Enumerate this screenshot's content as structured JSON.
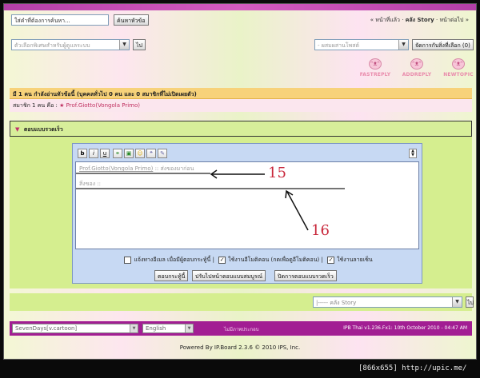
{
  "header": {
    "search_placeholder": "ใส่คำที่ต้องการค้นหา...",
    "search_button": "ค้นหาหัวข้อ",
    "nav_prev": "« หน้าที่แล้ว",
    "nav_separator": "·",
    "nav_current": "คลัง Story",
    "nav_next": "หน้าต่อไป »"
  },
  "moderation": {
    "left_select": "ตัวเลือกพิเศษสำหรับผู้ดูแลระบบ",
    "left_go": "ไป",
    "right_select": "- ผสมผสานโพสต์",
    "clear_button": "จัดการกับสิ่งที่เลือก (0)"
  },
  "action_buttons": [
    "FASTREPLY",
    "ADDREPLY",
    "NEWTOPIC"
  ],
  "viewing": {
    "header": "มี 1 คน กำลังอ่านหัวข้อนี้ (บุคคลทั่วไป 0 คน และ 0 สมาชิกที่ไม่เปิดเผยตัว)",
    "members_label": "สมาชิก 1 คน คือ :",
    "member_name": "Prof.Giotto(Vongola Primo)"
  },
  "quick_reply": {
    "title": "ตอบแบบรวดเร็ว",
    "toolbar_icons": [
      "bold-icon",
      "italic-icon",
      "underline-icon",
      "link-icon",
      "image-icon",
      "smiley-icon",
      "quote-icon",
      "spellcheck-icon"
    ],
    "toolbar_letters": [
      "b",
      "i",
      "u"
    ],
    "textarea_line1_name": "Prof.Giotto(Vongola Primo)",
    "textarea_line1_rest": " :: ส่งของมาก่อน",
    "textarea_line2": "สิ่งของ ::",
    "annotation_15": "15",
    "annotation_16": "16",
    "option_track": "แจ้งทางอีเมล เมื่อมีผู้ตอบกระทู้นี้",
    "option_emoticons": "ใช้งานอีโมติคอน (กดเพื่อดูอีโมติคอน)",
    "option_signature": "ใช้งานลายเซ็น",
    "post_button": "ตอบกระทู้นี้",
    "full_editor_button": "ปรับไปหน้าตอบแบบสมบูรณ์",
    "close_button": "ปิดการตอบแบบรวดเร็ว"
  },
  "jump": {
    "select": "|-----  คลัง Story",
    "go": "ไป"
  },
  "footer": {
    "skin_select": "SevenDays[v.cartoon]",
    "lang_select": "English",
    "no_pictures": "ไม่มีภาพประกอบ",
    "version": "IPB Thai v1.236.Fx1: 10th October 2010 - 04:47 AM",
    "powered": "Powered By IP.Board 2.3.6 © 2010  IPS, Inc."
  },
  "caption": "[866x655] http://upic.me/",
  "colors": {
    "top_bar": "#b43fa8",
    "viewing_header": "#f7d27a",
    "quick_reply_bg": "#d5ee8f",
    "editor_panel": "#c7d9f3",
    "annotation": "#c8263a",
    "bottom_bar": "#a21e93"
  }
}
